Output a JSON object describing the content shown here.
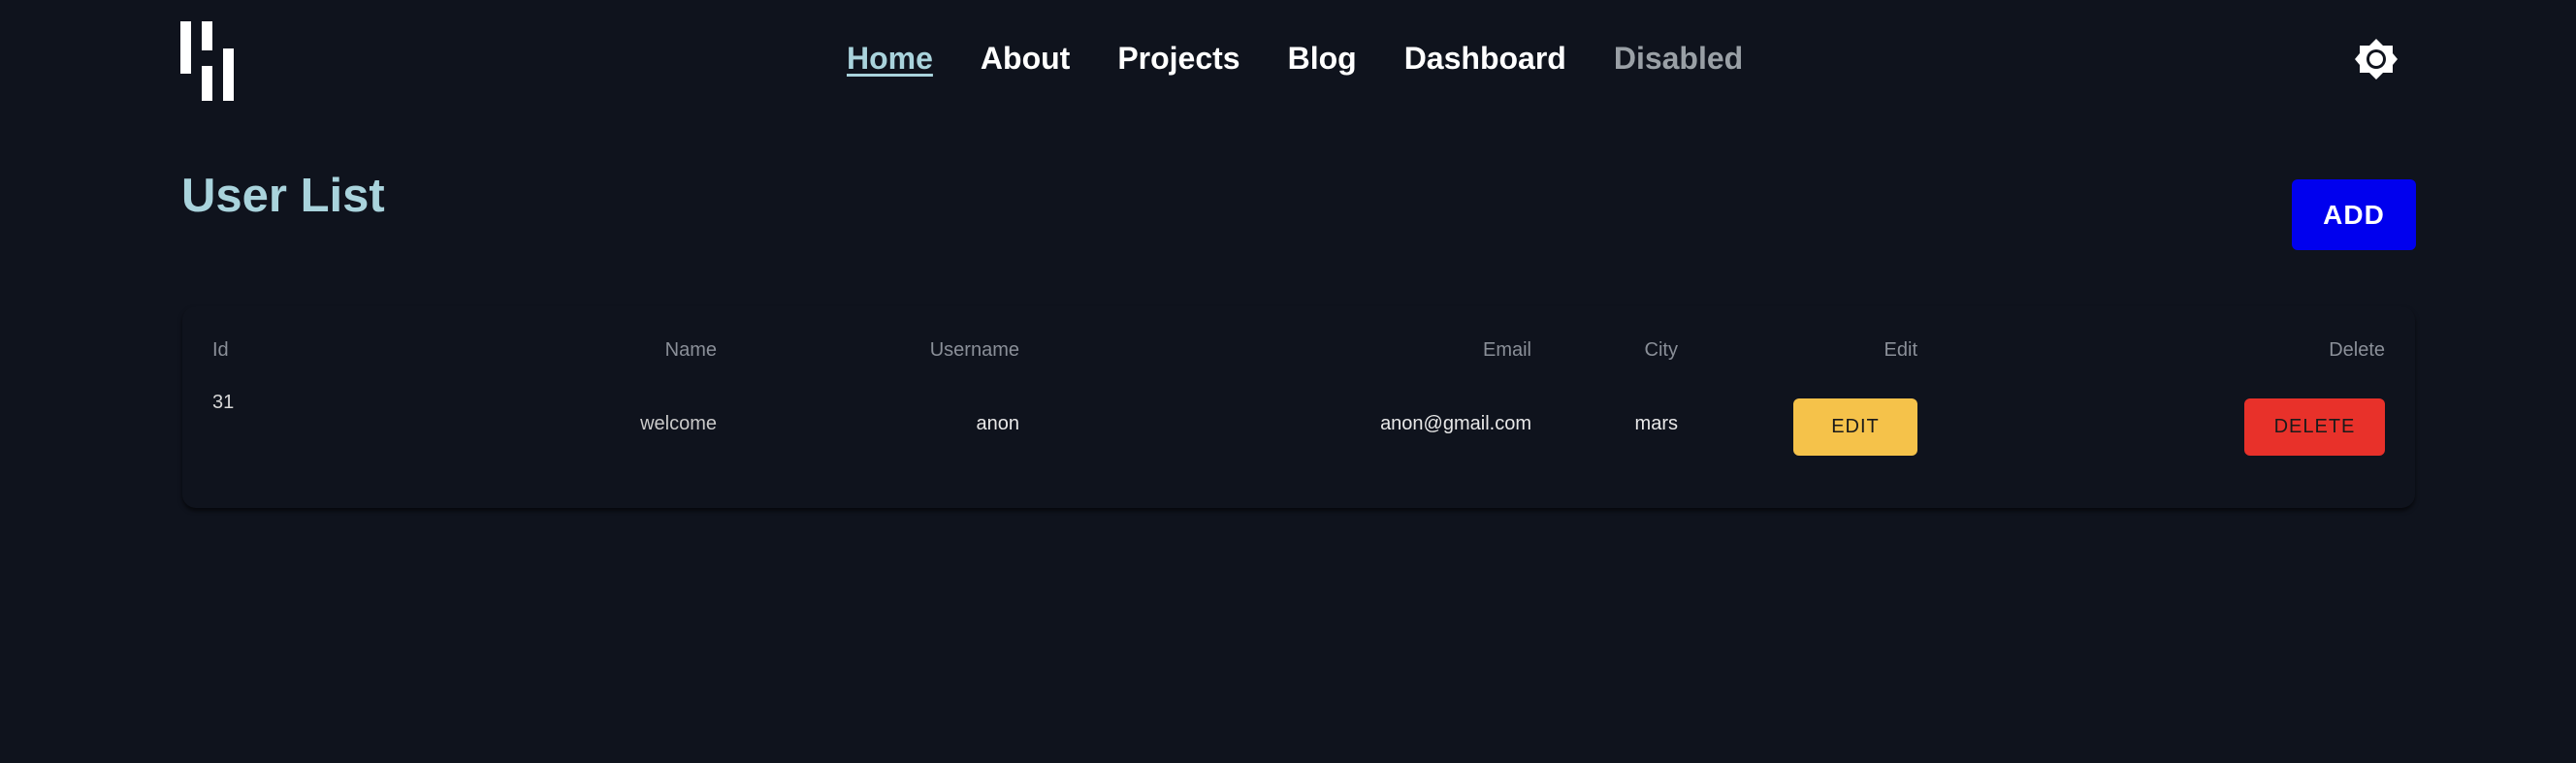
{
  "header": {
    "nav": [
      {
        "label": "Home",
        "state": "active"
      },
      {
        "label": "About",
        "state": "normal"
      },
      {
        "label": "Projects",
        "state": "normal"
      },
      {
        "label": "Blog",
        "state": "normal"
      },
      {
        "label": "Dashboard",
        "state": "normal"
      },
      {
        "label": "Disabled",
        "state": "disabled"
      }
    ],
    "logo_icon": "logo-icon",
    "theme_icon": "sun-icon"
  },
  "main": {
    "title": "User List",
    "add_label": "ADD"
  },
  "table": {
    "columns": [
      "Id",
      "Name",
      "Username",
      "Email",
      "City",
      "Edit",
      "Delete"
    ],
    "rows": [
      {
        "id": "31",
        "name": "welcome",
        "username": "anon",
        "email": "anon@gmail.com",
        "city": "mars",
        "edit_label": "EDIT",
        "delete_label": "DELETE"
      }
    ]
  },
  "colors": {
    "background": "#0f131d",
    "accent": "#a9d3dc",
    "add_button": "#0000ee",
    "edit_button": "#f5c24a",
    "delete_button": "#e8312a"
  }
}
